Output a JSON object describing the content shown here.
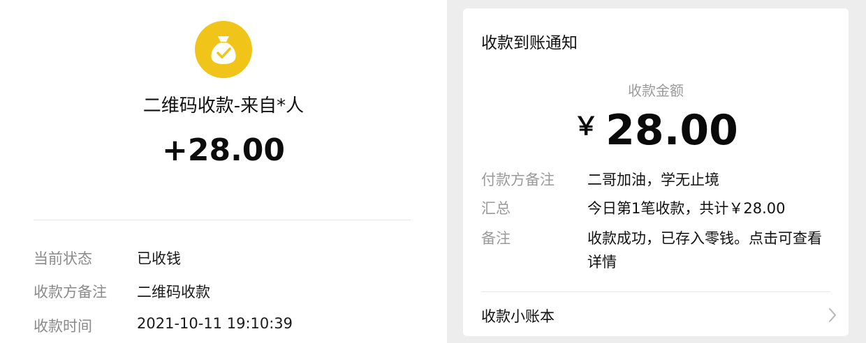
{
  "left": {
    "icon": "money-bag-check-icon",
    "title": "二维码收款-来自*人",
    "amount": "+28.00",
    "details": [
      {
        "label": "当前状态",
        "value": "已收钱"
      },
      {
        "label": "收款方备注",
        "value": "二维码收款"
      },
      {
        "label": "收款时间",
        "value": "2021-10-11 19:10:39"
      }
    ]
  },
  "right": {
    "title": "收款到账通知",
    "amount_label": "收款金额",
    "currency": "￥",
    "amount": "28.00",
    "rows": [
      {
        "label": "付款方备注",
        "value": "二哥加油，学无止境"
      },
      {
        "label": "汇总",
        "value": "今日第1笔收款，共计￥28.00"
      },
      {
        "label": "备注",
        "value": "收款成功，已存入零钱。点击可查看详情"
      }
    ],
    "ledger_label": "收款小账本",
    "ledger_icon": "chevron-right-icon"
  },
  "colors": {
    "coin": "#f0c419",
    "background_gray": "#ededed"
  }
}
